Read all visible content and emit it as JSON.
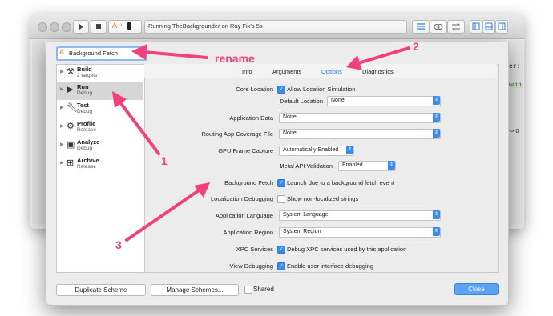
{
  "window": {
    "activity_text": "Running TheBackgrounder on Ray Fix's 5s"
  },
  "scheme_name": "Background Fetch",
  "sidebar": {
    "items": [
      {
        "title": "Build",
        "subtitle": "2 targets",
        "icon": "hammer-icon"
      },
      {
        "title": "Run",
        "subtitle": "Debug",
        "icon": "play-icon"
      },
      {
        "title": "Test",
        "subtitle": "Debug",
        "icon": "wrench-icon"
      },
      {
        "title": "Profile",
        "subtitle": "Release",
        "icon": "gauge-icon"
      },
      {
        "title": "Analyze",
        "subtitle": "Debug",
        "icon": "analyze-icon"
      },
      {
        "title": "Archive",
        "subtitle": "Release",
        "icon": "archive-icon"
      }
    ]
  },
  "tabs": [
    "Info",
    "Arguments",
    "Options",
    "Diagnostics"
  ],
  "options": {
    "core_location": {
      "label": "Core Location",
      "checkbox": "Allow Location Simulation"
    },
    "default_location": {
      "label": "Default Location",
      "value": "None"
    },
    "application_data": {
      "label": "Application Data",
      "value": "None"
    },
    "routing_file": {
      "label": "Routing App Coverage File",
      "value": "None"
    },
    "gpu_capture": {
      "label": "GPU Frame Capture",
      "value": "Automatically Enabled"
    },
    "metal_validation": {
      "label": "Metal API Validation",
      "value": "Enabled"
    },
    "background_fetch": {
      "label": "Background Fetch",
      "checkbox": "Launch due to a background fetch event"
    },
    "localization": {
      "label": "Localization Debugging",
      "checkbox": "Show non-localized strings"
    },
    "app_language": {
      "label": "Application Language",
      "value": "System Language"
    },
    "app_region": {
      "label": "Application Region",
      "value": "System Region"
    },
    "xpc": {
      "label": "XPC Services",
      "checkbox": "Debug XPC services used by this application"
    },
    "view_debugging": {
      "label": "View Debugging",
      "checkbox": "Enable user interface debugging"
    }
  },
  "footer": {
    "duplicate": "Duplicate Scheme",
    "manage": "Manage Schemes...",
    "shared": "Shared",
    "close": "Close"
  },
  "annotations": {
    "rename": "rename",
    "n1": "1",
    "n2": "2",
    "n3": "3"
  },
  "colors": {
    "accent": "#3b8bef",
    "annotation": "#f0417c",
    "active_tab": "#2f7de0"
  },
  "background_fragments": {
    "r1": "er:",
    "r2": "ist 1.1",
    "r3": "-> 0"
  }
}
